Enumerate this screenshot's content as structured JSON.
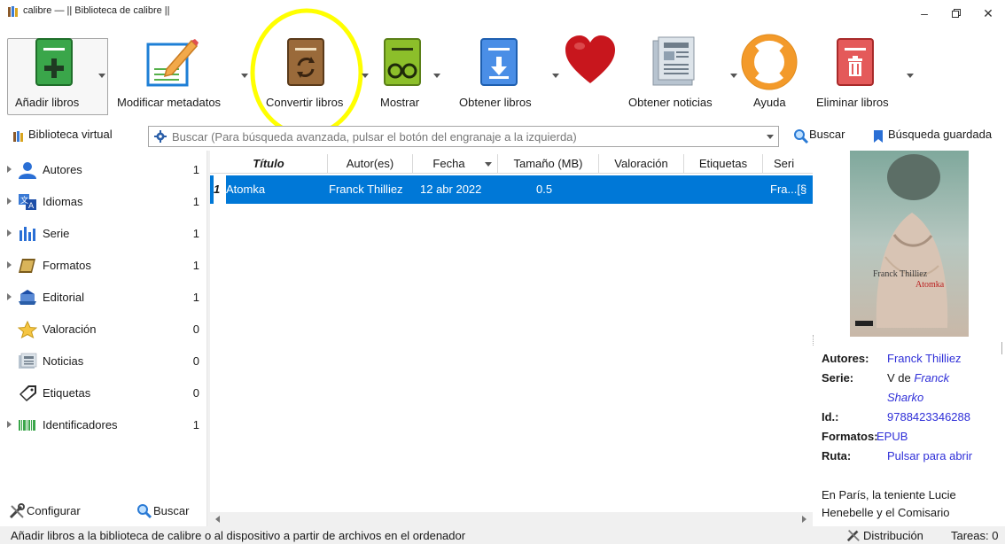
{
  "window": {
    "title": "calibre — || Biblioteca de calibre ||",
    "minimize_icon": "minimize-icon",
    "restore_icon": "restore-icon",
    "close_icon": "close-icon"
  },
  "toolbar": {
    "add_books": "Añadir libros",
    "edit_metadata": "Modificar metadatos",
    "convert_books": "Convertir libros",
    "view": "Mostrar",
    "get_books": "Obtener libros",
    "fetch_news": "Obtener noticias",
    "help": "Ayuda",
    "remove_books": "Eliminar libros"
  },
  "search_row": {
    "virtual_library": "Biblioteca virtual",
    "search_placeholder": "Buscar (Para búsqueda avanzada, pulsar el botón del engranaje a la izquierda)",
    "search_button": "Buscar",
    "saved_search": "Búsqueda guardada"
  },
  "tag_browser": {
    "items": [
      {
        "label": "Autores",
        "count": "1"
      },
      {
        "label": "Idiomas",
        "count": "1"
      },
      {
        "label": "Serie",
        "count": "1"
      },
      {
        "label": "Formatos",
        "count": "1"
      },
      {
        "label": "Editorial",
        "count": "1"
      },
      {
        "label": "Valoración",
        "count": "0"
      },
      {
        "label": "Noticias",
        "count": "0"
      },
      {
        "label": "Etiquetas",
        "count": "0"
      },
      {
        "label": "Identificadores",
        "count": "1"
      }
    ],
    "configure": "Configurar",
    "find": "Buscar"
  },
  "book_list": {
    "columns": [
      "Título",
      "Autor(es)",
      "Fecha",
      "Tamaño (MB)",
      "Valoración",
      "Etiquetas",
      "Seri"
    ],
    "rows": [
      {
        "index": "1",
        "title": "Atomka",
        "author": "Franck Thilliez",
        "date": "12 abr 2022",
        "size": "0.5",
        "series": "Fra...[§"
      }
    ]
  },
  "book_details": {
    "cover_author": "Franck Thilliez",
    "cover_title": "Atomka",
    "authors_key": "Autores:",
    "authors_val": "Franck Thilliez",
    "series_key": "Serie:",
    "series_val_prefix": "V de",
    "series_val_link": "Franck",
    "series_val_link2": "Sharko",
    "id_key": "Id.:",
    "id_val": "9788423346288",
    "formats_key": "Formatos:",
    "formats_val": "EPUB",
    "path_key": "Ruta:",
    "path_val": "Pulsar para abrir",
    "desc_line1": "En París, la teniente Lucie",
    "desc_line2": "Henebelle y el Comisario"
  },
  "status_bar": {
    "message": "Añadir libros a la biblioteca de calibre o al dispositivo a partir de archivos en el ordenador",
    "layout": "Distribución",
    "jobs": "Tareas: 0"
  },
  "colors": {
    "selection": "#0078d7",
    "highlight_circle": "#ffff00",
    "link": "#2f2fd8"
  }
}
